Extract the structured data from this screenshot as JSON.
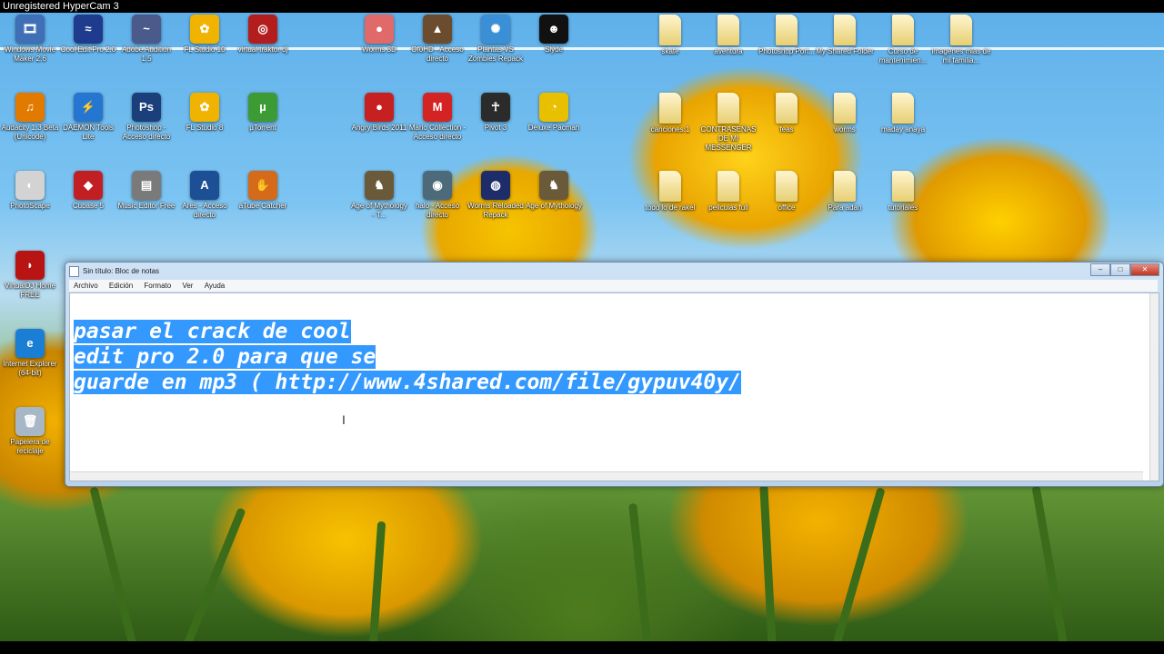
{
  "watermark": "Unregistered HyperCam 3",
  "desktop_icons": [
    {
      "label": "Windows Movie Maker 2.6",
      "glyph": "🎞",
      "color": "#3f6fb6",
      "folder": false
    },
    {
      "label": "Cool Edit Pro 2.0",
      "glyph": "≈",
      "color": "#1e3b8e",
      "folder": false
    },
    {
      "label": "Adobe Audition 1.5",
      "glyph": "~",
      "color": "#4a5a8a",
      "folder": false
    },
    {
      "label": "FL Studio 10",
      "glyph": "✿",
      "color": "#f0b400",
      "folder": false
    },
    {
      "label": "virtual traktor dj",
      "glyph": "◎",
      "color": "#b31d1d",
      "folder": false
    },
    {
      "label": "Worms 3D",
      "glyph": "●",
      "color": "#e06a6a",
      "folder": false
    },
    {
      "label": "Of0HD - Acceso directo",
      "glyph": "▲",
      "color": "#6b4c2e",
      "folder": false
    },
    {
      "label": "Plantas VS Zombies Repack",
      "glyph": "✺",
      "color": "#3a8fd6",
      "folder": false
    },
    {
      "label": "Slyde",
      "glyph": "☻",
      "color": "#111111",
      "folder": false
    },
    {
      "label": "skate",
      "glyph": "",
      "color": "",
      "folder": true
    },
    {
      "label": "aventura",
      "glyph": "",
      "color": "",
      "folder": true
    },
    {
      "label": "Photoshop Port...",
      "glyph": "",
      "color": "",
      "folder": true
    },
    {
      "label": "My Shared Folder",
      "glyph": "",
      "color": "",
      "folder": true
    },
    {
      "label": "Curso de mantenimien...",
      "glyph": "",
      "color": "",
      "folder": true
    },
    {
      "label": "imagenes mias de mi familia...",
      "glyph": "",
      "color": "",
      "folder": true
    },
    {
      "label": "Audacity 1.3 Beta (Unicode)",
      "glyph": "♫",
      "color": "#e27a00",
      "folder": false
    },
    {
      "label": "DAEMON Tools Lite",
      "glyph": "⚡",
      "color": "#2576d1",
      "folder": false
    },
    {
      "label": "Photoshop - Acceso directo",
      "glyph": "Ps",
      "color": "#1b3f7a",
      "folder": false
    },
    {
      "label": "FL Studio 8",
      "glyph": "✿",
      "color": "#f0b400",
      "folder": false
    },
    {
      "label": "µTorrent",
      "glyph": "µ",
      "color": "#3d9b35",
      "folder": false
    },
    {
      "label": "Angry Birds 2011",
      "glyph": "●",
      "color": "#c72020",
      "folder": false
    },
    {
      "label": "Mario Collection - Acceso directo",
      "glyph": "M",
      "color": "#d32323",
      "folder": false
    },
    {
      "label": "Pivot 3",
      "glyph": "☥",
      "color": "#2b2b2b",
      "folder": false
    },
    {
      "label": "Deluxe Pacman",
      "glyph": "◔",
      "color": "#e8c000",
      "folder": false
    },
    {
      "label": "canciones.1",
      "glyph": "",
      "color": "",
      "folder": true
    },
    {
      "label": "CONTRASEÑAS DE MI MESSENGER",
      "glyph": "",
      "color": "",
      "folder": true
    },
    {
      "label": "feas",
      "glyph": "",
      "color": "",
      "folder": true
    },
    {
      "label": "worms",
      "glyph": "",
      "color": "",
      "folder": true
    },
    {
      "label": "maday anaya",
      "glyph": "",
      "color": "",
      "folder": true
    },
    {
      "label": "PhotoScape",
      "glyph": "◐",
      "color": "#d3d3d3",
      "folder": false
    },
    {
      "label": "Cubase 5",
      "glyph": "◆",
      "color": "#c21f25",
      "folder": false
    },
    {
      "label": "Music Editor Free",
      "glyph": "▤",
      "color": "#7a7a7a",
      "folder": false
    },
    {
      "label": "Ares - Acceso directo",
      "glyph": "A",
      "color": "#1c4f94",
      "folder": false
    },
    {
      "label": "aTube Catcher",
      "glyph": "✋",
      "color": "#d46a1a",
      "folder": false
    },
    {
      "label": "Age of Mythology - T...",
      "glyph": "♞",
      "color": "#6a5a3a",
      "folder": false
    },
    {
      "label": "halo - Acceso directo",
      "glyph": "◉",
      "color": "#4d6a7a",
      "folder": false
    },
    {
      "label": "Worms Reloaded Repack",
      "glyph": "◍",
      "color": "#1e2d6a",
      "folder": false
    },
    {
      "label": "Age of Mythology",
      "glyph": "♞",
      "color": "#6a5a3a",
      "folder": false
    },
    {
      "label": "todo lo de rakel",
      "glyph": "",
      "color": "",
      "folder": true
    },
    {
      "label": "peliculas full",
      "glyph": "",
      "color": "",
      "folder": true
    },
    {
      "label": "office",
      "glyph": "",
      "color": "",
      "folder": true
    },
    {
      "label": "Para adan",
      "glyph": "",
      "color": "",
      "folder": true
    },
    {
      "label": "tutoriales",
      "glyph": "",
      "color": "",
      "folder": true
    },
    {
      "label": "VirtualDJ Home FREE",
      "glyph": "◗",
      "color": "#b81414",
      "folder": false
    },
    {
      "label": "Internet Explorer (64-bit)",
      "glyph": "e",
      "color": "#1a7fd4",
      "folder": false
    },
    {
      "label": "Papelera de reciclaje",
      "glyph": "🗑",
      "color": "#a8b7c6",
      "folder": false
    }
  ],
  "notepad": {
    "title": "Sin título: Bloc de notas",
    "controls": {
      "minimize": "–",
      "maximize": "□",
      "close": "✕"
    },
    "menu": [
      "Archivo",
      "Edición",
      "Formato",
      "Ver",
      "Ayuda"
    ],
    "text_lines": [
      "pasar el crack de cool",
      "edit pro 2.0 para que se",
      "guarde en mp3 ( http://www.4shared.com/file/gypuv40y/"
    ]
  },
  "cursor": "I"
}
